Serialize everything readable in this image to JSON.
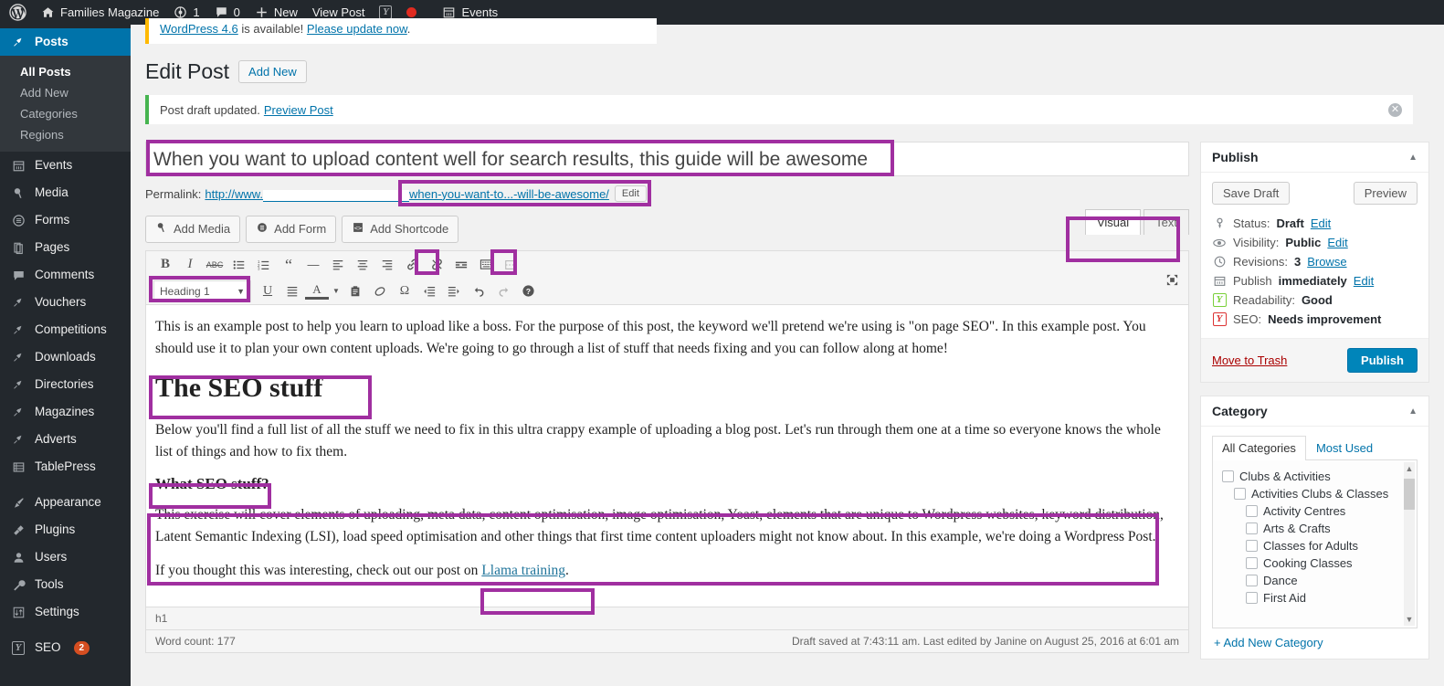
{
  "adminbar": {
    "site_name": "Families Magazine",
    "updates_count": "1",
    "comments_count": "0",
    "new_label": "New",
    "view_post_label": "View Post",
    "events_label": "Events",
    "icons": {
      "wp_logo": "wordpress-logo-icon",
      "home": "home-icon",
      "updates": "updates-icon",
      "comments": "comment-bubble-icon",
      "plus": "plus-icon",
      "yoast": "yoast-icon",
      "reddot": "red-dot-icon",
      "calendar": "calendar-icon"
    }
  },
  "sidebar": {
    "current": "Posts",
    "items": [
      {
        "label": "Posts",
        "icon": "pin-icon",
        "current": true
      },
      {
        "label": "Events",
        "icon": "calendar-icon"
      },
      {
        "label": "Media",
        "icon": "media-icon"
      },
      {
        "label": "Forms",
        "icon": "forms-icon"
      },
      {
        "label": "Pages",
        "icon": "pages-icon"
      },
      {
        "label": "Comments",
        "icon": "comment-bubble-icon"
      },
      {
        "label": "Vouchers",
        "icon": "pin-icon"
      },
      {
        "label": "Competitions",
        "icon": "pin-icon"
      },
      {
        "label": "Downloads",
        "icon": "pin-icon"
      },
      {
        "label": "Directories",
        "icon": "pin-icon"
      },
      {
        "label": "Magazines",
        "icon": "pin-icon"
      },
      {
        "label": "Adverts",
        "icon": "pin-icon"
      },
      {
        "label": "TablePress",
        "icon": "table-icon"
      },
      {
        "label": "Appearance",
        "icon": "brush-icon",
        "sep_before": true
      },
      {
        "label": "Plugins",
        "icon": "plug-icon"
      },
      {
        "label": "Users",
        "icon": "user-icon"
      },
      {
        "label": "Tools",
        "icon": "wrench-icon"
      },
      {
        "label": "Settings",
        "icon": "sliders-icon"
      },
      {
        "label": "SEO",
        "icon": "yoast-icon",
        "badge": "2",
        "sep_before": true
      }
    ],
    "submenu": [
      {
        "label": "All Posts",
        "current": true
      },
      {
        "label": "Add New"
      },
      {
        "label": "Categories"
      },
      {
        "label": "Regions"
      }
    ]
  },
  "notices": {
    "update": {
      "link1": "WordPress 4.6",
      "middle": " is available! ",
      "link2": "Please update now",
      "tail": "."
    },
    "updated": {
      "text": "Post draft updated.",
      "link": "Preview Post"
    }
  },
  "header": {
    "title": "Edit Post",
    "add_new_label": "Add New"
  },
  "post": {
    "title": "When you want to upload content well for search results, this guide will be awesome",
    "permalink_label": "Permalink:",
    "permalink_prefix": "http://www.",
    "permalink_slug": "when-you-want-to...-will-be-awesome/",
    "edit_slug_label": "Edit"
  },
  "media_buttons": [
    {
      "label": "Add Media",
      "icon": "add-media-icon"
    },
    {
      "label": "Add Form",
      "icon": "add-form-icon"
    },
    {
      "label": "Add Shortcode",
      "icon": "add-shortcode-icon"
    }
  ],
  "editor_tabs": [
    {
      "label": "Visual",
      "active": true
    },
    {
      "label": "Text",
      "active": false
    }
  ],
  "toolbar": {
    "format_select": "Heading 1",
    "row1": [
      {
        "name": "bold-icon",
        "glyph": "B"
      },
      {
        "name": "italic-icon",
        "glyph": "I"
      },
      {
        "name": "strikethrough-icon",
        "glyph": "ABC"
      },
      {
        "name": "bulleted-list-icon",
        "glyph": "☰"
      },
      {
        "name": "numbered-list-icon",
        "glyph": "☰"
      },
      {
        "name": "blockquote-icon",
        "glyph": "“"
      },
      {
        "name": "horizontal-rule-icon",
        "glyph": "—"
      },
      {
        "name": "align-left-icon",
        "glyph": "≡"
      },
      {
        "name": "align-center-icon",
        "glyph": "≡"
      },
      {
        "name": "align-right-icon",
        "glyph": "≡"
      },
      {
        "name": "insert-link-icon",
        "glyph": "⚭",
        "highlighted": true
      },
      {
        "name": "unlink-icon",
        "glyph": "⚭"
      },
      {
        "name": "read-more-icon",
        "glyph": "☰"
      },
      {
        "name": "toggle-toolbar-icon",
        "glyph": "⌸",
        "highlighted": true
      },
      {
        "name": "page-break-icon",
        "glyph": "⌸",
        "dim": true
      }
    ],
    "row2": [
      {
        "name": "underline-icon",
        "glyph": "U"
      },
      {
        "name": "justify-icon",
        "glyph": "≡"
      },
      {
        "name": "text-color-icon",
        "glyph": "A"
      },
      {
        "name": "text-color-dropdown-icon",
        "glyph": "▾"
      },
      {
        "name": "paste-as-text-icon",
        "glyph": "⎙"
      },
      {
        "name": "clear-formatting-icon",
        "glyph": "⬭"
      },
      {
        "name": "special-character-icon",
        "glyph": "Ω"
      },
      {
        "name": "outdent-icon",
        "glyph": "⇤"
      },
      {
        "name": "indent-icon",
        "glyph": "⇥"
      },
      {
        "name": "undo-icon",
        "glyph": "↶"
      },
      {
        "name": "redo-icon",
        "glyph": "↷",
        "dim": true
      },
      {
        "name": "keyboard-shortcuts-icon",
        "glyph": "?"
      }
    ],
    "dfw_icon": "distraction-free-writing-icon"
  },
  "body": {
    "p1": "This is an example post to help you learn to upload like a boss.  For the purpose of this post, the keyword we'll pretend we're using is \"on page SEO\".  In this example post.  You should use it to plan your own content uploads.  We're going to go through a list of stuff that needs fixing and you can follow along at home!",
    "h1": "The SEO stuff",
    "p2": "Below you'll find a full list of all the stuff we need to fix in this ultra crappy example of uploading a blog post.  Let's run through them one at a time so everyone knows the whole list of things and how to fix them.",
    "h2": "What SEO stuff?",
    "p3": "This exercise will cover elements of uploading, meta data, content optimisation, image optimisation, Yoast, elements that are unique to Wordpress websites, keyword distribution, Latent Semantic Indexing (LSI), load speed optimisation and other things that first time content uploaders might not know about.  In this example, we're doing a Wordpress Post.",
    "p4_prefix": "If you thought this was interesting, check out our post on ",
    "p4_link": "Llama training",
    "p4_suffix": "."
  },
  "statusbar": {
    "path": "h1",
    "word_count": "Word count: 177",
    "saved_info": "Draft saved at 7:43:11 am. Last edited by Janine on August 25, 2016 at 6:01 am"
  },
  "publish_box": {
    "title": "Publish",
    "save_draft": "Save Draft",
    "preview": "Preview",
    "rows": [
      {
        "icon": "key-icon",
        "label": "Status: ",
        "value": "Draft",
        "action": "Edit"
      },
      {
        "icon": "eye-icon",
        "label": "Visibility: ",
        "value": "Public",
        "action": "Edit"
      },
      {
        "icon": "clock-icon",
        "label": "Revisions: ",
        "value": "3",
        "action": "Browse"
      },
      {
        "icon": "calendar-icon",
        "label": "Publish ",
        "value": "immediately",
        "action": "Edit"
      },
      {
        "icon": "yoast-good-icon",
        "label": "Readability: ",
        "value": "Good",
        "action": ""
      },
      {
        "icon": "yoast-bad-icon",
        "label": "SEO: ",
        "value": "Needs improvement",
        "action": ""
      }
    ],
    "trash": "Move to Trash",
    "publish": "Publish"
  },
  "category_box": {
    "title": "Category",
    "tabs": [
      {
        "label": "All Categories",
        "active": true
      },
      {
        "label": "Most Used",
        "active": false
      }
    ],
    "items": [
      {
        "label": "Clubs & Activities",
        "depth": 0,
        "checked": false
      },
      {
        "label": "Activities Clubs & Classes",
        "depth": 1,
        "checked": false
      },
      {
        "label": "Activity Centres",
        "depth": 2,
        "checked": false
      },
      {
        "label": "Arts & Crafts",
        "depth": 2,
        "checked": false
      },
      {
        "label": "Classes for Adults",
        "depth": 2,
        "checked": false
      },
      {
        "label": "Cooking Classes",
        "depth": 2,
        "checked": false
      },
      {
        "label": "Dance",
        "depth": 2,
        "checked": false
      },
      {
        "label": "First Aid",
        "depth": 2,
        "checked": false
      }
    ],
    "add_new": "+ Add New Category"
  },
  "annotation_color": "#a02fa0"
}
